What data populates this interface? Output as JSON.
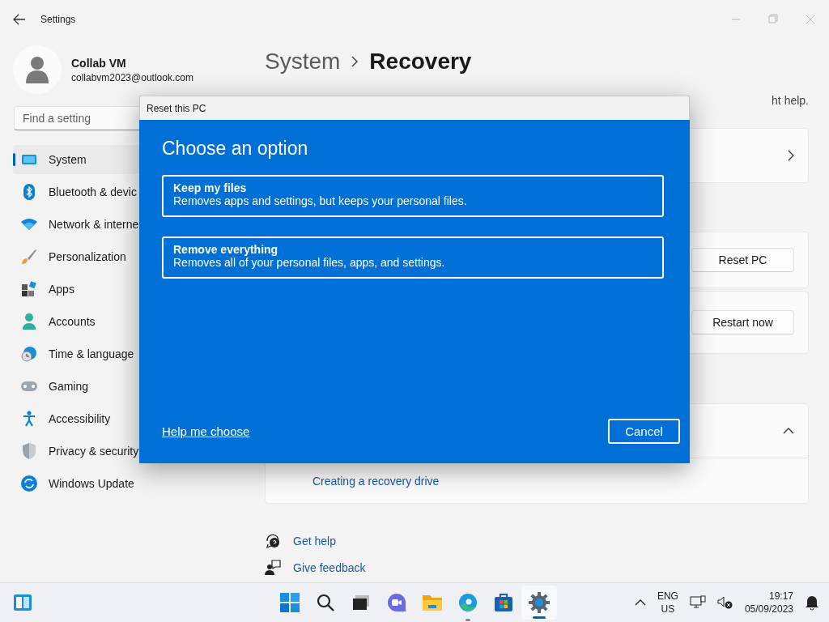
{
  "window": {
    "title": "Settings"
  },
  "account": {
    "name": "Collab VM",
    "email": "collabvm2023@outlook.com"
  },
  "search": {
    "placeholder": "Find a setting"
  },
  "sidebar": {
    "items": [
      {
        "label": "System",
        "selected": true
      },
      {
        "label": "Bluetooth & devic",
        "selected": false
      },
      {
        "label": "Network & interne",
        "selected": false
      },
      {
        "label": "Personalization",
        "selected": false
      },
      {
        "label": "Apps",
        "selected": false
      },
      {
        "label": "Accounts",
        "selected": false
      },
      {
        "label": "Time & language",
        "selected": false
      },
      {
        "label": "Gaming",
        "selected": false
      },
      {
        "label": "Accessibility",
        "selected": false
      },
      {
        "label": "Privacy & security",
        "selected": false
      },
      {
        "label": "Windows Update",
        "selected": false
      }
    ]
  },
  "breadcrumb": {
    "parent": "System",
    "current": "Recovery"
  },
  "description_tail": "ht help.",
  "cards": [
    {
      "kind": "chevron"
    },
    {
      "kind": "button",
      "button": "Reset PC"
    },
    {
      "kind": "button",
      "button": "Restart now"
    },
    {
      "kind": "expander",
      "expanded": true,
      "link": "Creating a recovery drive"
    }
  ],
  "help_links": [
    {
      "label": "Get help"
    },
    {
      "label": "Give feedback"
    }
  ],
  "dialog": {
    "title": "Reset this PC",
    "heading": "Choose an option",
    "options": [
      {
        "title": "Keep my files",
        "description": "Removes apps and settings, but keeps your personal files."
      },
      {
        "title": "Remove everything",
        "description": "Removes all of your personal files, apps, and settings."
      }
    ],
    "link": "Help me choose",
    "cancel": "Cancel"
  },
  "taskbar": {
    "apps": [
      {
        "running": false,
        "selected": false
      },
      {
        "running": false,
        "selected": false
      },
      {
        "running": false,
        "selected": false
      },
      {
        "running": false,
        "selected": false
      },
      {
        "running": false,
        "selected": false
      },
      {
        "running": true,
        "selected": false
      },
      {
        "running": false,
        "selected": false
      },
      {
        "running": true,
        "selected": true
      }
    ],
    "language": "ENG",
    "region": "US",
    "time": "19:17",
    "date": "05/09/2023"
  }
}
